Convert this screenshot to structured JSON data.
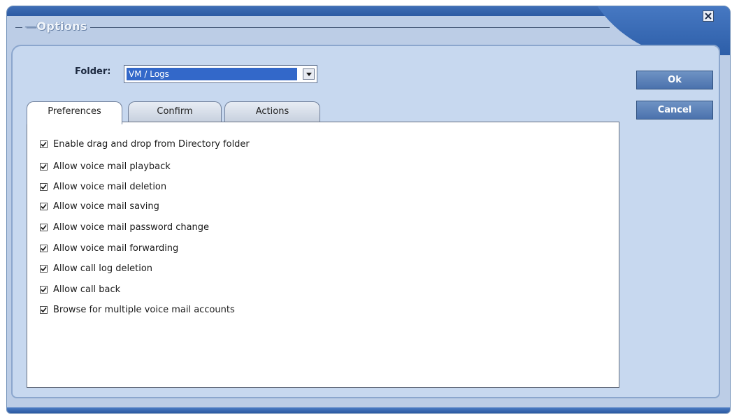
{
  "window": {
    "title": "Options",
    "close_label": "close"
  },
  "folder": {
    "label": "Folder:",
    "value": "VM / Logs"
  },
  "tabs": [
    {
      "label": "Preferences",
      "active": true
    },
    {
      "label": "Confirm",
      "active": false
    },
    {
      "label": "Actions",
      "active": false
    }
  ],
  "preferences": [
    {
      "label": "Enable drag and drop from Directory folder",
      "checked": true
    },
    {
      "label": "Allow voice mail playback",
      "checked": true
    },
    {
      "label": "Allow voice mail deletion",
      "checked": true
    },
    {
      "label": "Allow voice mail saving",
      "checked": true
    },
    {
      "label": "Allow voice mail password change",
      "checked": true
    },
    {
      "label": "Allow voice mail forwarding",
      "checked": true
    },
    {
      "label": "Allow call log deletion",
      "checked": true
    },
    {
      "label": "Allow call back",
      "checked": true
    },
    {
      "label": "Browse for multiple voice mail accounts",
      "checked": true
    }
  ],
  "buttons": {
    "ok_label": "Ok",
    "cancel_label": "Cancel"
  },
  "colors": {
    "accent": "#3368c9",
    "window_bg": "#bccde6",
    "button_bg": "#5a80b8"
  }
}
